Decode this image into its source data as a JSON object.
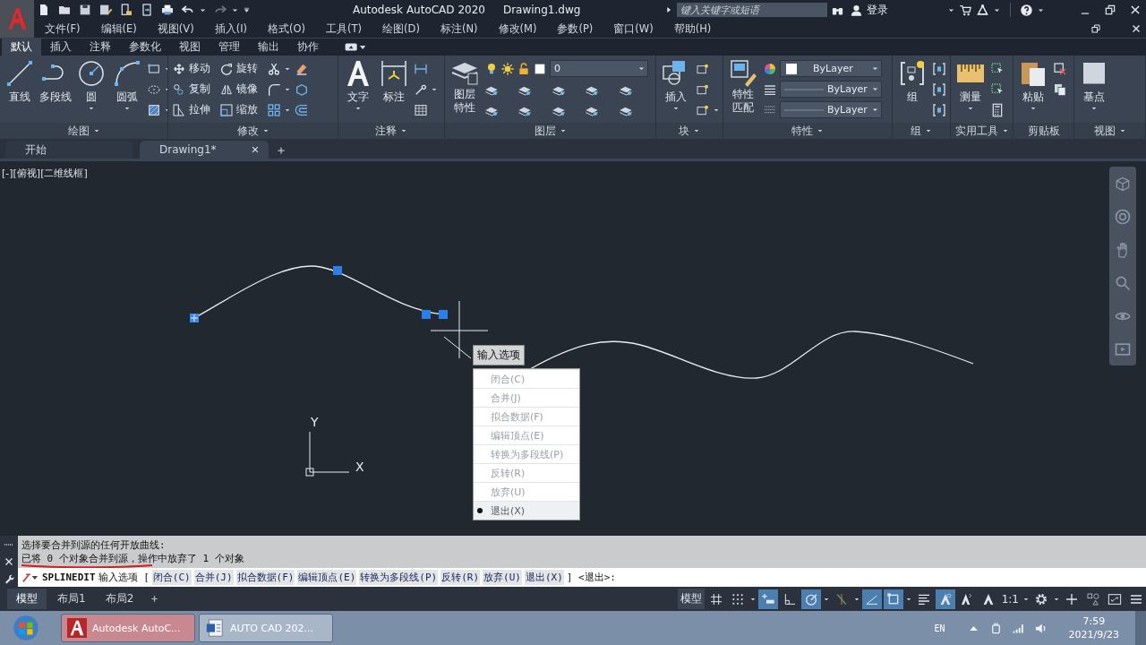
{
  "title_bar": {
    "app_title": "Autodesk AutoCAD 2020",
    "file_name": "Drawing1.dwg",
    "search_placeholder": "键入关键字或短语",
    "login": "登录"
  },
  "menu_bar": [
    "文件(F)",
    "编辑(E)",
    "视图(V)",
    "插入(I)",
    "格式(O)",
    "工具(T)",
    "绘图(D)",
    "标注(N)",
    "修改(M)",
    "参数(P)",
    "窗口(W)",
    "帮助(H)"
  ],
  "ribbon_tabs": [
    {
      "label": "默认",
      "selected": true
    },
    {
      "label": "插入",
      "selected": false
    },
    {
      "label": "注释",
      "selected": false
    },
    {
      "label": "参数化",
      "selected": false
    },
    {
      "label": "视图",
      "selected": false
    },
    {
      "label": "管理",
      "selected": false
    },
    {
      "label": "输出",
      "selected": false
    },
    {
      "label": "协作",
      "selected": false
    }
  ],
  "ribbon_panels": [
    {
      "title": "绘图",
      "tools": [
        {
          "kind": "large",
          "label": "直线"
        },
        {
          "kind": "large",
          "label": "多段线"
        },
        {
          "kind": "large",
          "label": "圆"
        },
        {
          "kind": "large",
          "label": "圆弧"
        },
        {
          "kind": "icon"
        },
        {
          "kind": "icon"
        },
        {
          "kind": "icon"
        }
      ]
    },
    {
      "title": "修改",
      "tools": [
        {
          "kind": "small",
          "label": "移动"
        },
        {
          "kind": "small",
          "label": "旋转"
        },
        {
          "kind": "icon"
        },
        {
          "kind": "icon"
        },
        {
          "kind": "small",
          "label": "复制"
        },
        {
          "kind": "small",
          "label": "镜像"
        },
        {
          "kind": "icon"
        },
        {
          "kind": "icon"
        },
        {
          "kind": "small",
          "label": "拉伸"
        },
        {
          "kind": "small",
          "label": "缩放"
        },
        {
          "kind": "icon"
        },
        {
          "kind": "icon"
        }
      ]
    },
    {
      "title": "注释",
      "tools": [
        {
          "kind": "large",
          "label": "文字"
        },
        {
          "kind": "large",
          "label": "标注"
        },
        {
          "kind": "icon"
        },
        {
          "kind": "icon"
        },
        {
          "kind": "icon"
        }
      ]
    },
    {
      "title": "图层",
      "tools": [
        {
          "kind": "stacked",
          "label": "图层特性"
        },
        {
          "kind": "dropdown",
          "label": "0"
        },
        {
          "kind": "icon"
        },
        {
          "kind": "icon"
        },
        {
          "kind": "icon"
        },
        {
          "kind": "icon"
        },
        {
          "kind": "icon"
        },
        {
          "kind": "icon"
        },
        {
          "kind": "icon"
        },
        {
          "kind": "icon"
        },
        {
          "kind": "icon"
        },
        {
          "kind": "icon"
        }
      ]
    },
    {
      "title": "块",
      "tools": [
        {
          "kind": "large",
          "label": "插入"
        },
        {
          "kind": "icon"
        },
        {
          "kind": "icon"
        },
        {
          "kind": "icon"
        }
      ]
    },
    {
      "title": "特性",
      "tools": [
        {
          "kind": "stacked",
          "label": "特性匹配"
        },
        {
          "kind": "dropdown",
          "label": "ByLayer"
        },
        {
          "kind": "dropdown",
          "label": "ByLayer"
        },
        {
          "kind": "dropdown",
          "label": "ByLayer"
        }
      ]
    },
    {
      "title": "组",
      "tools": [
        {
          "kind": "large",
          "label": "组"
        },
        {
          "kind": "icon"
        },
        {
          "kind": "icon"
        },
        {
          "kind": "icon"
        }
      ]
    },
    {
      "title": "实用工具",
      "tools": [
        {
          "kind": "large",
          "label": "测量"
        },
        {
          "kind": "icon"
        },
        {
          "kind": "icon"
        },
        {
          "kind": "icon"
        }
      ]
    },
    {
      "title": "剪贴板",
      "tools": [
        {
          "kind": "large",
          "label": "粘贴"
        },
        {
          "kind": "icon"
        },
        {
          "kind": "icon"
        }
      ]
    },
    {
      "title": "视图",
      "tools": [
        {
          "kind": "large",
          "label": "基点"
        }
      ]
    }
  ],
  "doc_tabs": [
    {
      "label": "开始",
      "selected": false
    },
    {
      "label": "Drawing1*",
      "selected": true
    }
  ],
  "viewport_label": "[-][俯视][二维线框]",
  "ucs": {
    "y_label": "Y",
    "x_label": "X"
  },
  "tooltip": "输入选项",
  "context_menu": [
    {
      "label": "闭合(C)",
      "selected": false
    },
    {
      "label": "合并(J)",
      "selected": false
    },
    {
      "label": "拟合数据(F)",
      "selected": false
    },
    {
      "label": "编辑顶点(E)",
      "selected": false
    },
    {
      "label": "转换为多段线(P)",
      "selected": false
    },
    {
      "label": "反转(R)",
      "selected": false
    },
    {
      "label": "放弃(U)",
      "selected": false
    },
    {
      "label": "退出(X)",
      "selected": true
    }
  ],
  "command_history": [
    "选择要合并到源的任何开放曲线:",
    "已将 0 个对象合并到源，操作中放弃了 1 个对象"
  ],
  "command_line": {
    "command": "SPLINEDIT",
    "prompt": "输入选项 [",
    "options": [
      "闭合(C)",
      "合并(J)",
      "拟合数据(F)",
      "编辑顶点(E)",
      "转换为多段线(P)",
      "反转(R)",
      "放弃(U)",
      "退出(X)"
    ],
    "suffix": "] <退出>:"
  },
  "layout_tabs": [
    {
      "label": "模型",
      "selected": true
    },
    {
      "label": "布局1",
      "selected": false
    },
    {
      "label": "布局2",
      "selected": false
    }
  ],
  "status_bar": {
    "space": "模型",
    "scale": "1:1",
    "toggles": [
      {
        "on": false
      },
      {
        "on": false
      },
      {
        "on": true
      },
      {
        "on": false
      },
      {
        "on": true
      },
      {
        "on": false
      },
      {
        "on": true
      },
      {
        "on": true
      },
      {
        "on": false
      },
      {
        "on": true
      },
      {
        "on": false
      },
      {
        "on": false
      }
    ]
  },
  "taskbar": {
    "tasks": [
      {
        "label": "Autodesk AutoC...",
        "selected": true
      },
      {
        "label": "AUTO  CAD 202...",
        "selected": false
      }
    ],
    "language": "EN",
    "time": "7:59",
    "date": "2021/9/23"
  }
}
